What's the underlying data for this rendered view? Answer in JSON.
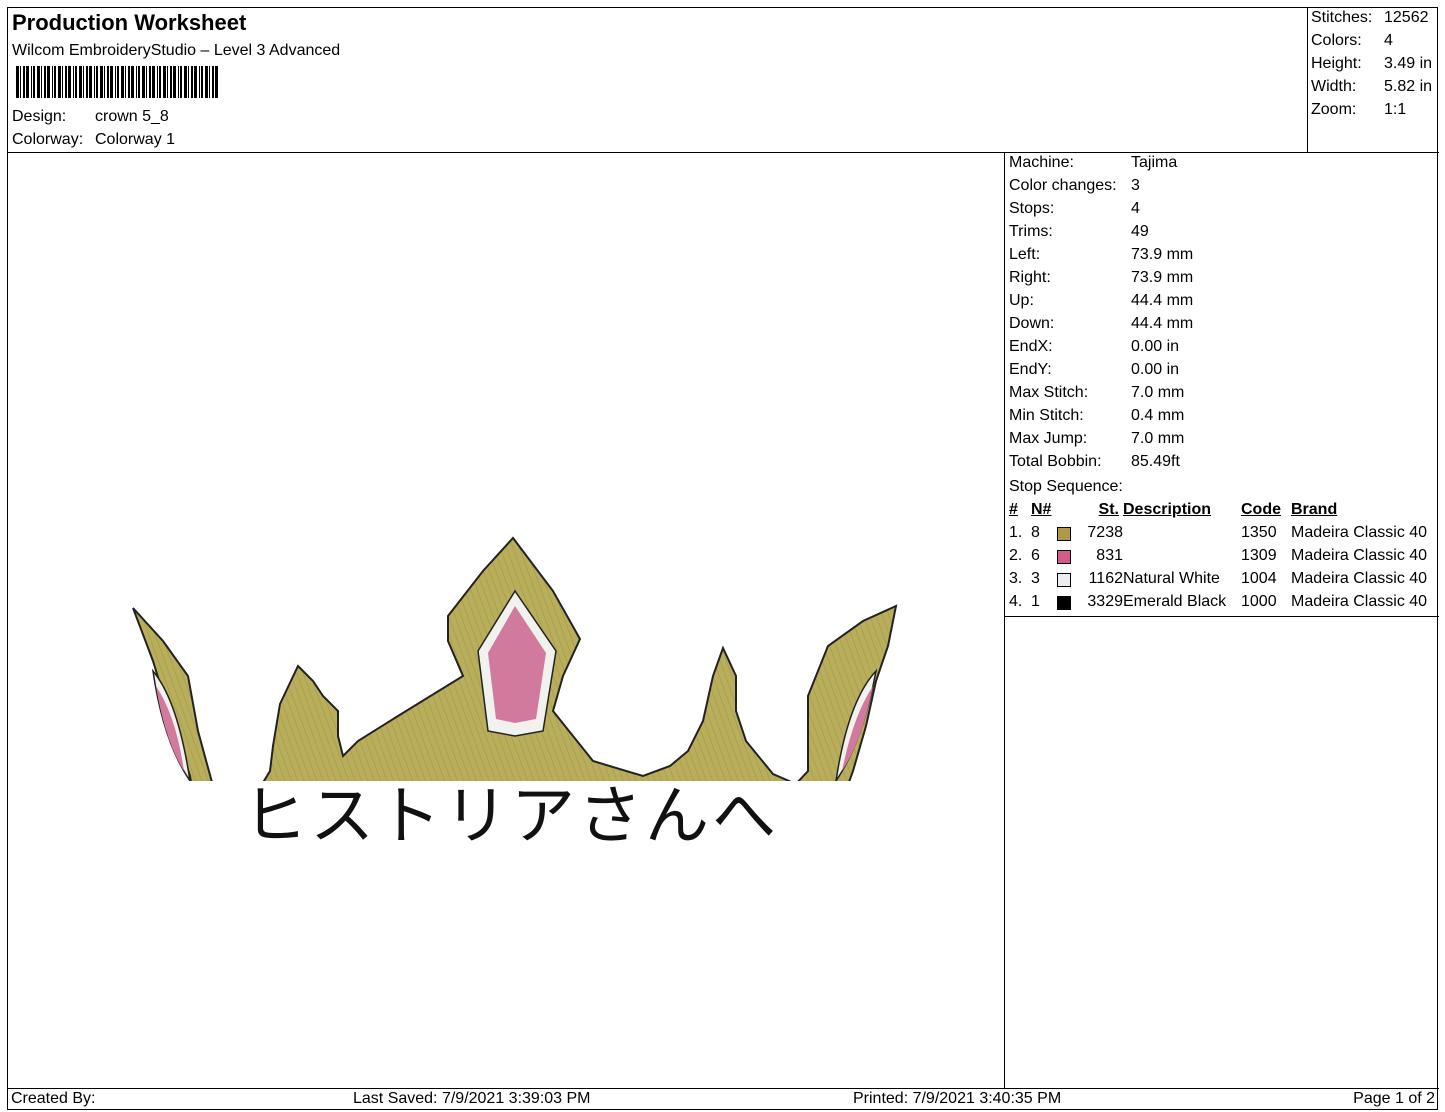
{
  "header": {
    "title": "Production Worksheet",
    "software": "Wilcom EmbroideryStudio – Level 3 Advanced",
    "design_label": "Design:",
    "design_value": "crown 5_8",
    "colorway_label": "Colorway:",
    "colorway_value": "Colorway 1"
  },
  "stats": [
    {
      "label": "Stitches:",
      "value": "12562"
    },
    {
      "label": "Colors:",
      "value": "4"
    },
    {
      "label": "Height:",
      "value": "3.49 in"
    },
    {
      "label": "Width:",
      "value": "5.82 in"
    },
    {
      "label": "Zoom:",
      "value": "1:1"
    }
  ],
  "machine": [
    {
      "label": "Machine:",
      "value": "Tajima"
    },
    {
      "label": "Color changes:",
      "value": "3"
    },
    {
      "label": "Stops:",
      "value": "4"
    },
    {
      "label": "Trims:",
      "value": "49"
    },
    {
      "label": "Left:",
      "value": "73.9 mm"
    },
    {
      "label": "Right:",
      "value": "73.9 mm"
    },
    {
      "label": "Up:",
      "value": "44.4 mm"
    },
    {
      "label": "Down:",
      "value": "44.4 mm"
    },
    {
      "label": "EndX:",
      "value": "0.00 in"
    },
    {
      "label": "EndY:",
      "value": "0.00 in"
    },
    {
      "label": "Max Stitch:",
      "value": "7.0 mm"
    },
    {
      "label": "Min Stitch:",
      "value": "0.4 mm"
    },
    {
      "label": "Max Jump:",
      "value": "7.0 mm"
    },
    {
      "label": "Total Bobbin:",
      "value": "85.49ft"
    }
  ],
  "stop_sequence": {
    "title": "Stop Sequence:",
    "headers": {
      "num": "#",
      "n": "N#",
      "st": "St.",
      "desc": "Description",
      "code": "Code",
      "brand": "Brand"
    },
    "rows": [
      {
        "num": "1.",
        "n": "8",
        "color": "#b19a45",
        "st": "7238",
        "desc": "",
        "code": "1350",
        "brand": "Madeira Classic 40"
      },
      {
        "num": "2.",
        "n": "6",
        "color": "#d45c8c",
        "st": "831",
        "desc": "",
        "code": "1309",
        "brand": "Madeira Classic 40"
      },
      {
        "num": "3.",
        "n": "3",
        "color": "#ececf2",
        "st": "1162",
        "desc": "Natural White",
        "code": "1004",
        "brand": "Madeira Classic 40"
      },
      {
        "num": "4.",
        "n": "1",
        "color": "#000000",
        "st": "3329",
        "desc": "Emerald Black",
        "code": "1000",
        "brand": "Madeira Classic 40"
      }
    ]
  },
  "design_preview": {
    "embroidered_text": "ヒストリアさんへ",
    "crown_color": "#b8ae5c",
    "gem_color": "#d27a9e",
    "outline_white": "#f1f1ee"
  },
  "footer": {
    "created_by": "Created By:",
    "last_saved": "Last Saved: 7/9/2021 3:39:03 PM",
    "printed": "Printed: 7/9/2021 3:40:35 PM",
    "page": "Page 1 of 2"
  }
}
